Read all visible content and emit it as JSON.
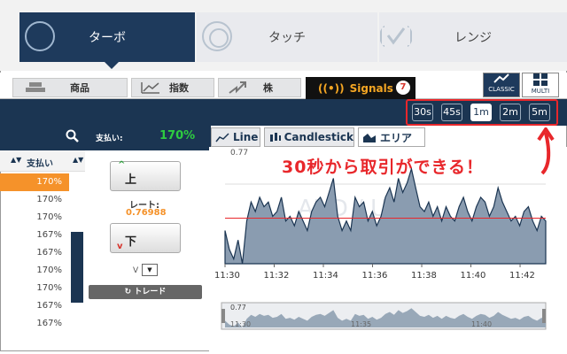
{
  "modes": [
    {
      "label": "ターボ",
      "active": true
    },
    {
      "label": "タッチ"
    },
    {
      "label": "レンジ"
    }
  ],
  "categories": [
    {
      "label": "商品"
    },
    {
      "label": "指数"
    },
    {
      "label": "株"
    }
  ],
  "signals": {
    "label": "Signals",
    "count": "7"
  },
  "view_buttons": {
    "classic": "CLASSIC",
    "multi": "MULTI"
  },
  "timeframes": [
    "30s",
    "45s",
    "1m",
    "2m",
    "5m"
  ],
  "selected_timeframe": "1m",
  "payout": {
    "header": "支払い:",
    "value": "170%",
    "col_header": "支払い",
    "rows": [
      "170%",
      "170%",
      "170%",
      "167%",
      "167%",
      "170%",
      "170%",
      "167%",
      "167%"
    ]
  },
  "trade": {
    "up": "上",
    "down": "下",
    "rate_label": "レート:",
    "rate": "0.76988",
    "v_label": "V",
    "trade_label": "トレード"
  },
  "chart_tabs": [
    "Line",
    "Candlestick",
    "エリア"
  ],
  "annotation": "30秒から取引ができる！",
  "chart_data": {
    "type": "area",
    "watermark": "AUD / USD",
    "y_tick": "0.77",
    "xticks": [
      "11:30",
      "11:32",
      "11:34",
      "11:36",
      "11:38",
      "11:40",
      "11:42"
    ],
    "ylim": [
      0.7694,
      0.7705
    ],
    "reference_line": 0.76988,
    "values": [
      0.76975,
      0.76955,
      0.76945,
      0.76965,
      0.7694,
      0.76985,
      0.77005,
      0.76995,
      0.7701,
      0.77,
      0.77005,
      0.7699,
      0.76995,
      0.7701,
      0.76985,
      0.7699,
      0.7698,
      0.76995,
      0.76985,
      0.76975,
      0.76995,
      0.77005,
      0.7701,
      0.77,
      0.77015,
      0.7703,
      0.7699,
      0.76975,
      0.76985,
      0.76975,
      0.7701,
      0.77,
      0.77005,
      0.76985,
      0.76995,
      0.7698,
      0.7699,
      0.7701,
      0.7702,
      0.77005,
      0.7703,
      0.77015,
      0.77025,
      0.7704,
      0.7702,
      0.77,
      0.76995,
      0.77005,
      0.7699,
      0.77,
      0.76985,
      0.77,
      0.7699,
      0.76985,
      0.77,
      0.7701,
      0.76995,
      0.76985,
      0.77,
      0.7701,
      0.77005,
      0.7699,
      0.77,
      0.7702,
      0.77005,
      0.76995,
      0.76985,
      0.7699,
      0.7698,
      0.76995,
      0.77,
      0.76985,
      0.76975,
      0.7699,
      0.76985
    ],
    "nav_labels": [
      "11:30",
      "11:35",
      "11:40"
    ],
    "nav_y_tick": "0.77"
  }
}
